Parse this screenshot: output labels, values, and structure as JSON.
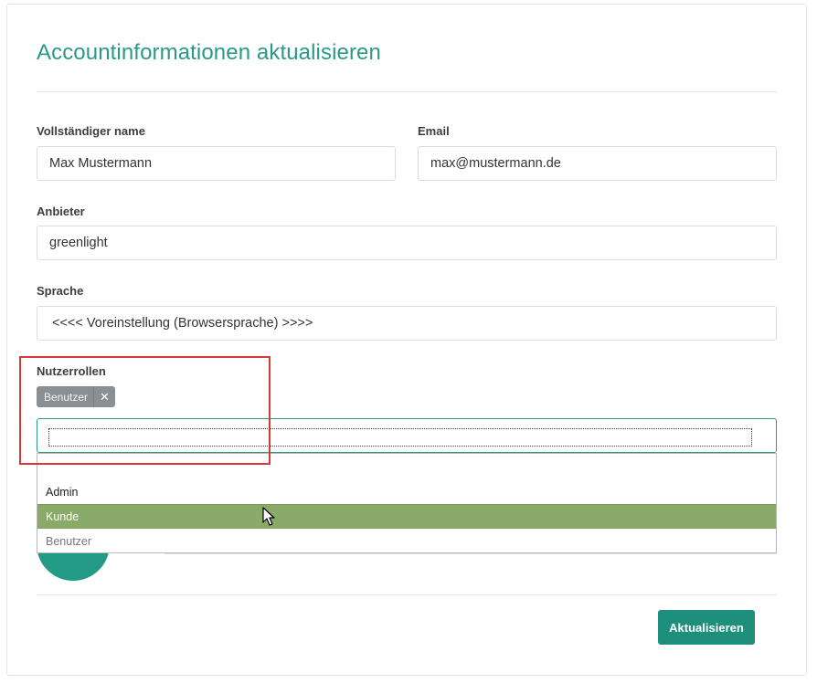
{
  "page": {
    "title": "Accountinformationen aktualisieren"
  },
  "form": {
    "full_name": {
      "label": "Vollständiger name",
      "value": "Max Mustermann"
    },
    "email": {
      "label": "Email",
      "value": "max@mustermann.de"
    },
    "provider": {
      "label": "Anbieter",
      "value": "greenlight"
    },
    "language": {
      "label": "Sprache",
      "value": "<<<< Voreinstellung (Browsersprache) >>>>"
    },
    "roles": {
      "label": "Nutzerrollen",
      "selected_tags": [
        {
          "label": "Benutzer",
          "remove_icon": "close-icon"
        }
      ],
      "search_value": "",
      "options": [
        {
          "label": "Admin",
          "state": "normal"
        },
        {
          "label": "Kunde",
          "state": "highlighted"
        },
        {
          "label": "Benutzer",
          "state": "disabled"
        }
      ]
    }
  },
  "actions": {
    "submit_label": "Aktualisieren"
  },
  "colors": {
    "accent": "#2a9a86",
    "button": "#1f8f7d",
    "option_highlight": "#8aaa6a",
    "tag_background": "#8a8f94",
    "annotation_box": "#d9383a"
  }
}
